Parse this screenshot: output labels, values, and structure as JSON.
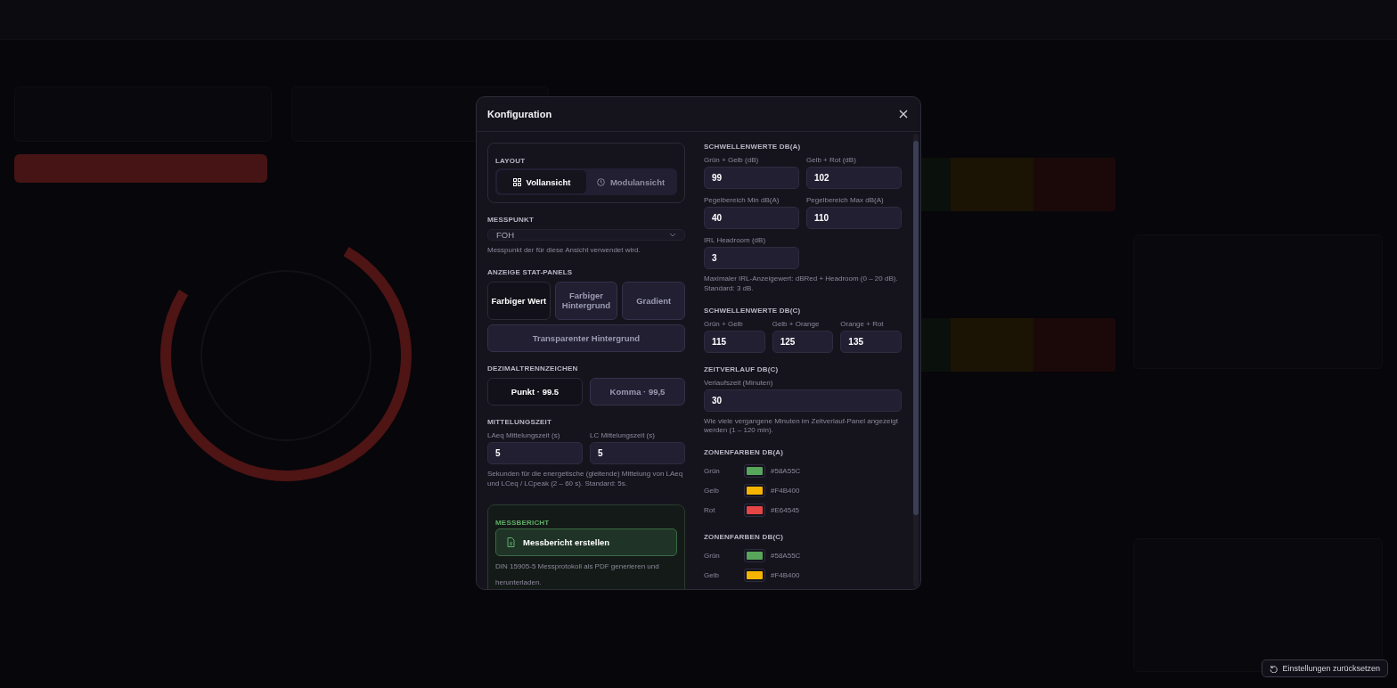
{
  "modal": {
    "title": "Konfiguration",
    "layout": {
      "heading": "LAYOUT",
      "options": [
        {
          "label": "Vollansicht",
          "selected": true
        },
        {
          "label": "Modulansicht",
          "selected": false
        }
      ]
    },
    "measuring_point": {
      "heading": "MESSPUNKT",
      "value": "FOH",
      "hint": "Messpunkt der für diese Ansicht verwendet wird."
    },
    "stat_panels": {
      "heading": "ANZEIGE STAT-PANELS",
      "options": [
        {
          "label": "Farbiger Wert",
          "selected": true
        },
        {
          "label": "Farbiger Hintergrund",
          "selected": false
        },
        {
          "label": "Gradient",
          "selected": false
        },
        {
          "label": "Transparenter Hintergrund",
          "selected": false
        }
      ]
    },
    "decimal": {
      "heading": "DEZIMALTRENNZEICHEN",
      "options": [
        {
          "label": "Punkt · 99.5",
          "selected": true
        },
        {
          "label": "Komma · 99,5",
          "selected": false
        }
      ]
    },
    "averaging": {
      "heading": "MITTELUNGSZEIT",
      "fields": [
        {
          "label": "LAeq Mittelungszeit (s)",
          "value": "5"
        },
        {
          "label": "LC Mittelungszeit (s)",
          "value": "5"
        }
      ],
      "hint": "Sekunden für die energetische (gleitende) Mittelung von LAeq und LCeq / LCpeak (2 – 60 s). Standard: 5s."
    },
    "report": {
      "heading": "MESSBERICHT",
      "button": "Messbericht erstellen",
      "hint": "DIN 15905-5 Messprotokoll als PDF generieren und herunterladen."
    },
    "thresholds_a": {
      "heading": "SCHWELLENWERTE DB(A)",
      "fields": [
        {
          "label": "Grün + Gelb (dB)",
          "value": "99"
        },
        {
          "label": "Gelb + Rot (dB)",
          "value": "102"
        },
        {
          "label": "Pegelbereich Min dB(A)",
          "value": "40"
        },
        {
          "label": "Pegelbereich Max dB(A)",
          "value": "110"
        },
        {
          "label": "IRL Headroom (dB)",
          "value": "3"
        }
      ],
      "hint": "Maximaler IRL-Anzeigewert: dBRed + Headroom (0 – 20 dB). Standard: 3 dB."
    },
    "thresholds_c": {
      "heading": "SCHWELLENWERTE DB(C)",
      "fields": [
        {
          "label": "Grün + Gelb",
          "value": "115"
        },
        {
          "label": "Gelb + Orange",
          "value": "125"
        },
        {
          "label": "Orange + Rot",
          "value": "135"
        }
      ]
    },
    "history": {
      "heading": "ZEITVERLAUF DB(C)",
      "field": {
        "label": "Verlaufszeit (Minuten)",
        "value": "30"
      },
      "hint": "Wie viele vergangene Minuten im Zeitverlauf-Panel angezeigt werden (1 – 120 min)."
    },
    "zone_colors_a": {
      "heading": "ZONENFARBEN DB(A)",
      "items": [
        {
          "label": "Grün",
          "color": "#58a55c",
          "hex": "#58A55C"
        },
        {
          "label": "Gelb",
          "color": "#f4b400",
          "hex": "#F4B400"
        },
        {
          "label": "Rot",
          "color": "#e64545",
          "hex": "#E64545"
        }
      ]
    },
    "zone_colors_c": {
      "heading": "ZONENFARBEN DB(C)",
      "items": [
        {
          "label": "Grün",
          "color": "#58a55c",
          "hex": "#58A55C"
        },
        {
          "label": "Gelb",
          "color": "#f4b400",
          "hex": "#F4B400"
        }
      ]
    }
  },
  "reset_button": "Einstellungen zurücksetzen"
}
